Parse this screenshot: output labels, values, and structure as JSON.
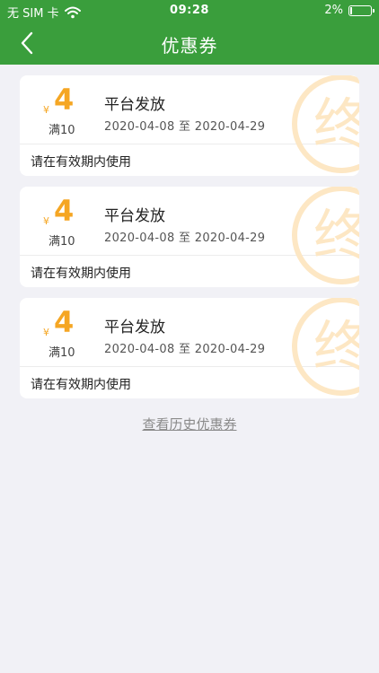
{
  "status_bar": {
    "carrier": "无 SIM 卡",
    "time": "09:28",
    "battery": "2%"
  },
  "nav": {
    "title": "优惠券"
  },
  "coupons": [
    {
      "currency": "¥",
      "amount": "4",
      "threshold": "满10",
      "title": "平台发放",
      "start_date": "2020-04-08",
      "date_separator": "至",
      "end_date": "2020-04-29",
      "note": "请在有效期内使用",
      "stamp_text": "终"
    },
    {
      "currency": "¥",
      "amount": "4",
      "threshold": "满10",
      "title": "平台发放",
      "start_date": "2020-04-08",
      "date_separator": "至",
      "end_date": "2020-04-29",
      "note": "请在有效期内使用",
      "stamp_text": "终"
    },
    {
      "currency": "¥",
      "amount": "4",
      "threshold": "满10",
      "title": "平台发放",
      "start_date": "2020-04-08",
      "date_separator": "至",
      "end_date": "2020-04-29",
      "note": "请在有效期内使用",
      "stamp_text": "终"
    }
  ],
  "history_link": "查看历史优惠券",
  "colors": {
    "brand_green": "#3a9e3c",
    "amount_orange": "#f5a623",
    "stamp_orange": "#fde7c4",
    "page_bg": "#f1f1f6"
  }
}
